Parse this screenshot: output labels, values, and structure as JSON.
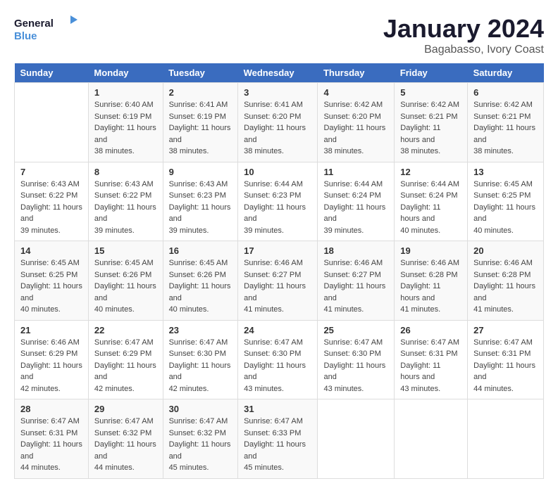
{
  "logo": {
    "line1": "General",
    "line2": "Blue"
  },
  "title": "January 2024",
  "subtitle": "Bagabasso, Ivory Coast",
  "colors": {
    "header_bg": "#3a6cbf",
    "accent": "#4a90d9"
  },
  "days_of_week": [
    "Sunday",
    "Monday",
    "Tuesday",
    "Wednesday",
    "Thursday",
    "Friday",
    "Saturday"
  ],
  "weeks": [
    [
      {
        "day": "",
        "sunrise": "",
        "sunset": "",
        "daylight": ""
      },
      {
        "day": "1",
        "sunrise": "Sunrise: 6:40 AM",
        "sunset": "Sunset: 6:19 PM",
        "daylight": "Daylight: 11 hours and 38 minutes."
      },
      {
        "day": "2",
        "sunrise": "Sunrise: 6:41 AM",
        "sunset": "Sunset: 6:19 PM",
        "daylight": "Daylight: 11 hours and 38 minutes."
      },
      {
        "day": "3",
        "sunrise": "Sunrise: 6:41 AM",
        "sunset": "Sunset: 6:20 PM",
        "daylight": "Daylight: 11 hours and 38 minutes."
      },
      {
        "day": "4",
        "sunrise": "Sunrise: 6:42 AM",
        "sunset": "Sunset: 6:20 PM",
        "daylight": "Daylight: 11 hours and 38 minutes."
      },
      {
        "day": "5",
        "sunrise": "Sunrise: 6:42 AM",
        "sunset": "Sunset: 6:21 PM",
        "daylight": "Daylight: 11 hours and 38 minutes."
      },
      {
        "day": "6",
        "sunrise": "Sunrise: 6:42 AM",
        "sunset": "Sunset: 6:21 PM",
        "daylight": "Daylight: 11 hours and 38 minutes."
      }
    ],
    [
      {
        "day": "7",
        "sunrise": "Sunrise: 6:43 AM",
        "sunset": "Sunset: 6:22 PM",
        "daylight": "Daylight: 11 hours and 39 minutes."
      },
      {
        "day": "8",
        "sunrise": "Sunrise: 6:43 AM",
        "sunset": "Sunset: 6:22 PM",
        "daylight": "Daylight: 11 hours and 39 minutes."
      },
      {
        "day": "9",
        "sunrise": "Sunrise: 6:43 AM",
        "sunset": "Sunset: 6:23 PM",
        "daylight": "Daylight: 11 hours and 39 minutes."
      },
      {
        "day": "10",
        "sunrise": "Sunrise: 6:44 AM",
        "sunset": "Sunset: 6:23 PM",
        "daylight": "Daylight: 11 hours and 39 minutes."
      },
      {
        "day": "11",
        "sunrise": "Sunrise: 6:44 AM",
        "sunset": "Sunset: 6:24 PM",
        "daylight": "Daylight: 11 hours and 39 minutes."
      },
      {
        "day": "12",
        "sunrise": "Sunrise: 6:44 AM",
        "sunset": "Sunset: 6:24 PM",
        "daylight": "Daylight: 11 hours and 40 minutes."
      },
      {
        "day": "13",
        "sunrise": "Sunrise: 6:45 AM",
        "sunset": "Sunset: 6:25 PM",
        "daylight": "Daylight: 11 hours and 40 minutes."
      }
    ],
    [
      {
        "day": "14",
        "sunrise": "Sunrise: 6:45 AM",
        "sunset": "Sunset: 6:25 PM",
        "daylight": "Daylight: 11 hours and 40 minutes."
      },
      {
        "day": "15",
        "sunrise": "Sunrise: 6:45 AM",
        "sunset": "Sunset: 6:26 PM",
        "daylight": "Daylight: 11 hours and 40 minutes."
      },
      {
        "day": "16",
        "sunrise": "Sunrise: 6:45 AM",
        "sunset": "Sunset: 6:26 PM",
        "daylight": "Daylight: 11 hours and 40 minutes."
      },
      {
        "day": "17",
        "sunrise": "Sunrise: 6:46 AM",
        "sunset": "Sunset: 6:27 PM",
        "daylight": "Daylight: 11 hours and 41 minutes."
      },
      {
        "day": "18",
        "sunrise": "Sunrise: 6:46 AM",
        "sunset": "Sunset: 6:27 PM",
        "daylight": "Daylight: 11 hours and 41 minutes."
      },
      {
        "day": "19",
        "sunrise": "Sunrise: 6:46 AM",
        "sunset": "Sunset: 6:28 PM",
        "daylight": "Daylight: 11 hours and 41 minutes."
      },
      {
        "day": "20",
        "sunrise": "Sunrise: 6:46 AM",
        "sunset": "Sunset: 6:28 PM",
        "daylight": "Daylight: 11 hours and 41 minutes."
      }
    ],
    [
      {
        "day": "21",
        "sunrise": "Sunrise: 6:46 AM",
        "sunset": "Sunset: 6:29 PM",
        "daylight": "Daylight: 11 hours and 42 minutes."
      },
      {
        "day": "22",
        "sunrise": "Sunrise: 6:47 AM",
        "sunset": "Sunset: 6:29 PM",
        "daylight": "Daylight: 11 hours and 42 minutes."
      },
      {
        "day": "23",
        "sunrise": "Sunrise: 6:47 AM",
        "sunset": "Sunset: 6:30 PM",
        "daylight": "Daylight: 11 hours and 42 minutes."
      },
      {
        "day": "24",
        "sunrise": "Sunrise: 6:47 AM",
        "sunset": "Sunset: 6:30 PM",
        "daylight": "Daylight: 11 hours and 43 minutes."
      },
      {
        "day": "25",
        "sunrise": "Sunrise: 6:47 AM",
        "sunset": "Sunset: 6:30 PM",
        "daylight": "Daylight: 11 hours and 43 minutes."
      },
      {
        "day": "26",
        "sunrise": "Sunrise: 6:47 AM",
        "sunset": "Sunset: 6:31 PM",
        "daylight": "Daylight: 11 hours and 43 minutes."
      },
      {
        "day": "27",
        "sunrise": "Sunrise: 6:47 AM",
        "sunset": "Sunset: 6:31 PM",
        "daylight": "Daylight: 11 hours and 44 minutes."
      }
    ],
    [
      {
        "day": "28",
        "sunrise": "Sunrise: 6:47 AM",
        "sunset": "Sunset: 6:31 PM",
        "daylight": "Daylight: 11 hours and 44 minutes."
      },
      {
        "day": "29",
        "sunrise": "Sunrise: 6:47 AM",
        "sunset": "Sunset: 6:32 PM",
        "daylight": "Daylight: 11 hours and 44 minutes."
      },
      {
        "day": "30",
        "sunrise": "Sunrise: 6:47 AM",
        "sunset": "Sunset: 6:32 PM",
        "daylight": "Daylight: 11 hours and 45 minutes."
      },
      {
        "day": "31",
        "sunrise": "Sunrise: 6:47 AM",
        "sunset": "Sunset: 6:33 PM",
        "daylight": "Daylight: 11 hours and 45 minutes."
      },
      {
        "day": "",
        "sunrise": "",
        "sunset": "",
        "daylight": ""
      },
      {
        "day": "",
        "sunrise": "",
        "sunset": "",
        "daylight": ""
      },
      {
        "day": "",
        "sunrise": "",
        "sunset": "",
        "daylight": ""
      }
    ]
  ]
}
